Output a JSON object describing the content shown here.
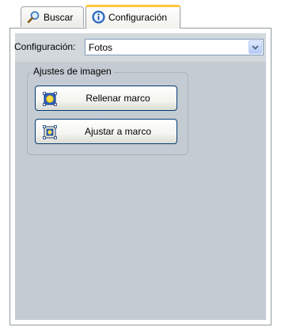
{
  "tabs": [
    {
      "label": "Buscar",
      "icon": "search-icon",
      "active": false
    },
    {
      "label": "Configuración",
      "icon": "info-icon",
      "active": true
    }
  ],
  "config": {
    "label": "Configuración:",
    "selected": "Fotos"
  },
  "image_settings": {
    "title": "Ajustes de imagen",
    "fill_button": "Rellenar marco",
    "fit_button": "Ajustar a marco"
  },
  "colors": {
    "panel_bg": "#c5cbd2",
    "active_tab_accent": "#ffc73c",
    "button_border": "#003c74"
  }
}
